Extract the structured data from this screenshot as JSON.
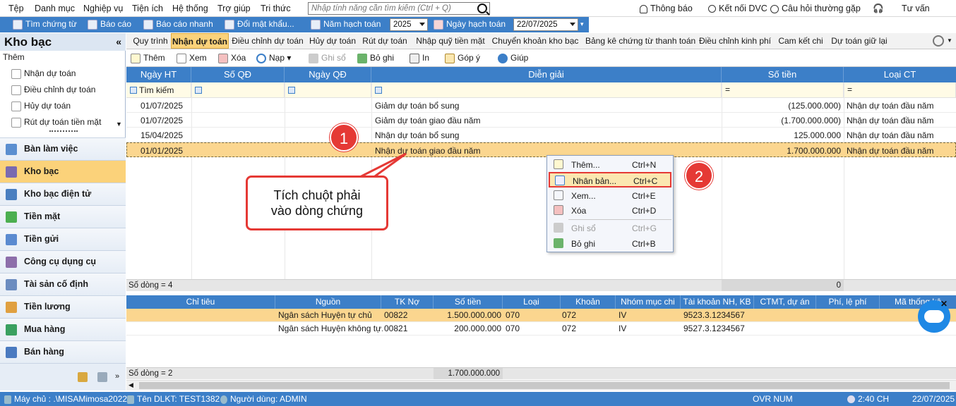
{
  "menubar": {
    "items": [
      "Tệp",
      "Danh mục",
      "Nghiệp vụ",
      "Tiện ích",
      "Hệ thống",
      "Trợ giúp",
      "Tri thức"
    ],
    "search_placeholder": "Nhập tính năng cần tìm kiếm (Ctrl + Q)",
    "right": [
      "Thông báo",
      "Kết nối DVC",
      "Câu hỏi thường gặp",
      "Tư vấn"
    ]
  },
  "toolbar2": {
    "items": [
      "Tìm chứng từ",
      "Báo cáo",
      "Báo cáo nhanh",
      "Đổi mật khẩu..."
    ],
    "year_label": "Năm hạch toán",
    "year_value": "2025",
    "date_label": "Ngày hạch toán",
    "date_value": "22/07/2025"
  },
  "leftpanel": {
    "title": "Kho bạc",
    "collapse": "«",
    "section": "Thêm",
    "subitems": [
      "Nhận dự toán",
      "Điều chỉnh dự toán",
      "Hủy dự toán",
      "Rút dự toán tiền mặt"
    ],
    "nav": [
      "Bàn làm việc",
      "Kho bạc",
      "Kho bạc điện tử",
      "Tiền mặt",
      "Tiền gửi",
      "Công cụ dụng cụ",
      "Tài sản cố định",
      "Tiền lương",
      "Mua hàng",
      "Bán hàng"
    ],
    "active": "Kho bạc"
  },
  "tabs": [
    "Quy trình",
    "Nhận dự toán",
    "Điều chỉnh dự toán",
    "Hủy dự toán",
    "Rút dự toán",
    "Nhập quỹ tiền mặt",
    "Chuyển khoản kho bạc",
    "Bảng kê chứng từ thanh toán",
    "Điều chỉnh kinh phí",
    "Cam kết chi",
    "Dự toán giữ lại"
  ],
  "actions": {
    "add": "Thêm",
    "view": "Xem",
    "delete": "Xóa",
    "load": "Nạp",
    "post": "Ghi sổ",
    "unpost": "Bỏ ghi",
    "print": "In",
    "feedback": "Góp ý",
    "help": "Giúp"
  },
  "grid": {
    "headers": [
      "Ngày HT",
      "Số QĐ",
      "Ngày QĐ",
      "Diễn giải",
      "Số tiền",
      "Loại CT"
    ],
    "search_label": "Tìm kiếm",
    "rows": [
      {
        "date": "01/07/2025",
        "desc": "Giảm dự toán bổ sung",
        "amount": "(125.000.000)",
        "type": "Nhận dự toán đầu năm"
      },
      {
        "date": "01/07/2025",
        "desc": "Giảm dự toán giao đầu năm",
        "amount": "(1.700.000.000)",
        "type": "Nhận dự toán đầu năm"
      },
      {
        "date": "15/04/2025",
        "desc": "Nhận dự toán bổ sung",
        "amount": "125.000.000",
        "type": "Nhận dự toán đầu năm"
      },
      {
        "date": "01/01/2025",
        "desc": "Nhận dự toán giao đầu năm",
        "amount": "1.700.000.000",
        "type": "Nhận dự toán đầu năm"
      }
    ],
    "row_count": "Số dòng = 4",
    "total": "0"
  },
  "detail": {
    "headers": [
      "Chỉ tiêu",
      "Nguồn",
      "TK Nợ",
      "Số tiền",
      "Loại",
      "Khoản",
      "Nhóm mục chi",
      "Tài khoản NH, KB",
      "CTMT, dự án",
      "Phí, lệ phí",
      "Mã thống kê"
    ],
    "rows": [
      {
        "source": "Ngân sách Huyện tự chủ",
        "tk": "00822",
        "amount": "1.500.000.000",
        "loai": "070",
        "khoan": "072",
        "group": "IV",
        "account": "9523.3.1234567"
      },
      {
        "source": "Ngân sách Huyện không tự...",
        "tk": "00821",
        "amount": "200.000.000",
        "loai": "070",
        "khoan": "072",
        "group": "IV",
        "account": "9527.3.1234567"
      }
    ],
    "row_count": "Số dòng = 2",
    "total": "1.700.000.000"
  },
  "contextmenu": [
    {
      "label": "Thêm...",
      "shortcut": "Ctrl+N"
    },
    {
      "label": "Nhân bản...",
      "shortcut": "Ctrl+C"
    },
    {
      "label": "Xem...",
      "shortcut": "Ctrl+E"
    },
    {
      "label": "Xóa",
      "shortcut": "Ctrl+D"
    },
    {
      "label": "Ghi sổ",
      "shortcut": "Ctrl+G"
    },
    {
      "label": "Bỏ ghi",
      "shortcut": "Ctrl+B"
    }
  ],
  "annotations": {
    "badge1": "1",
    "badge2": "2",
    "callout_line1": "Tích chuột phải",
    "callout_line2": "vào dòng chứng"
  },
  "statusbar": {
    "server": "Máy chủ : .\\MISAMimosa2022",
    "db": "Tên DLKT: TEST1382",
    "user": "Người dùng: ADMIN",
    "mode": "OVR  NUM",
    "time": "2:40 CH",
    "date": "22/07/2025"
  },
  "colors": {
    "accent": "#3c7fc8",
    "highlight": "#fbd27a",
    "annotation": "#e53935"
  }
}
